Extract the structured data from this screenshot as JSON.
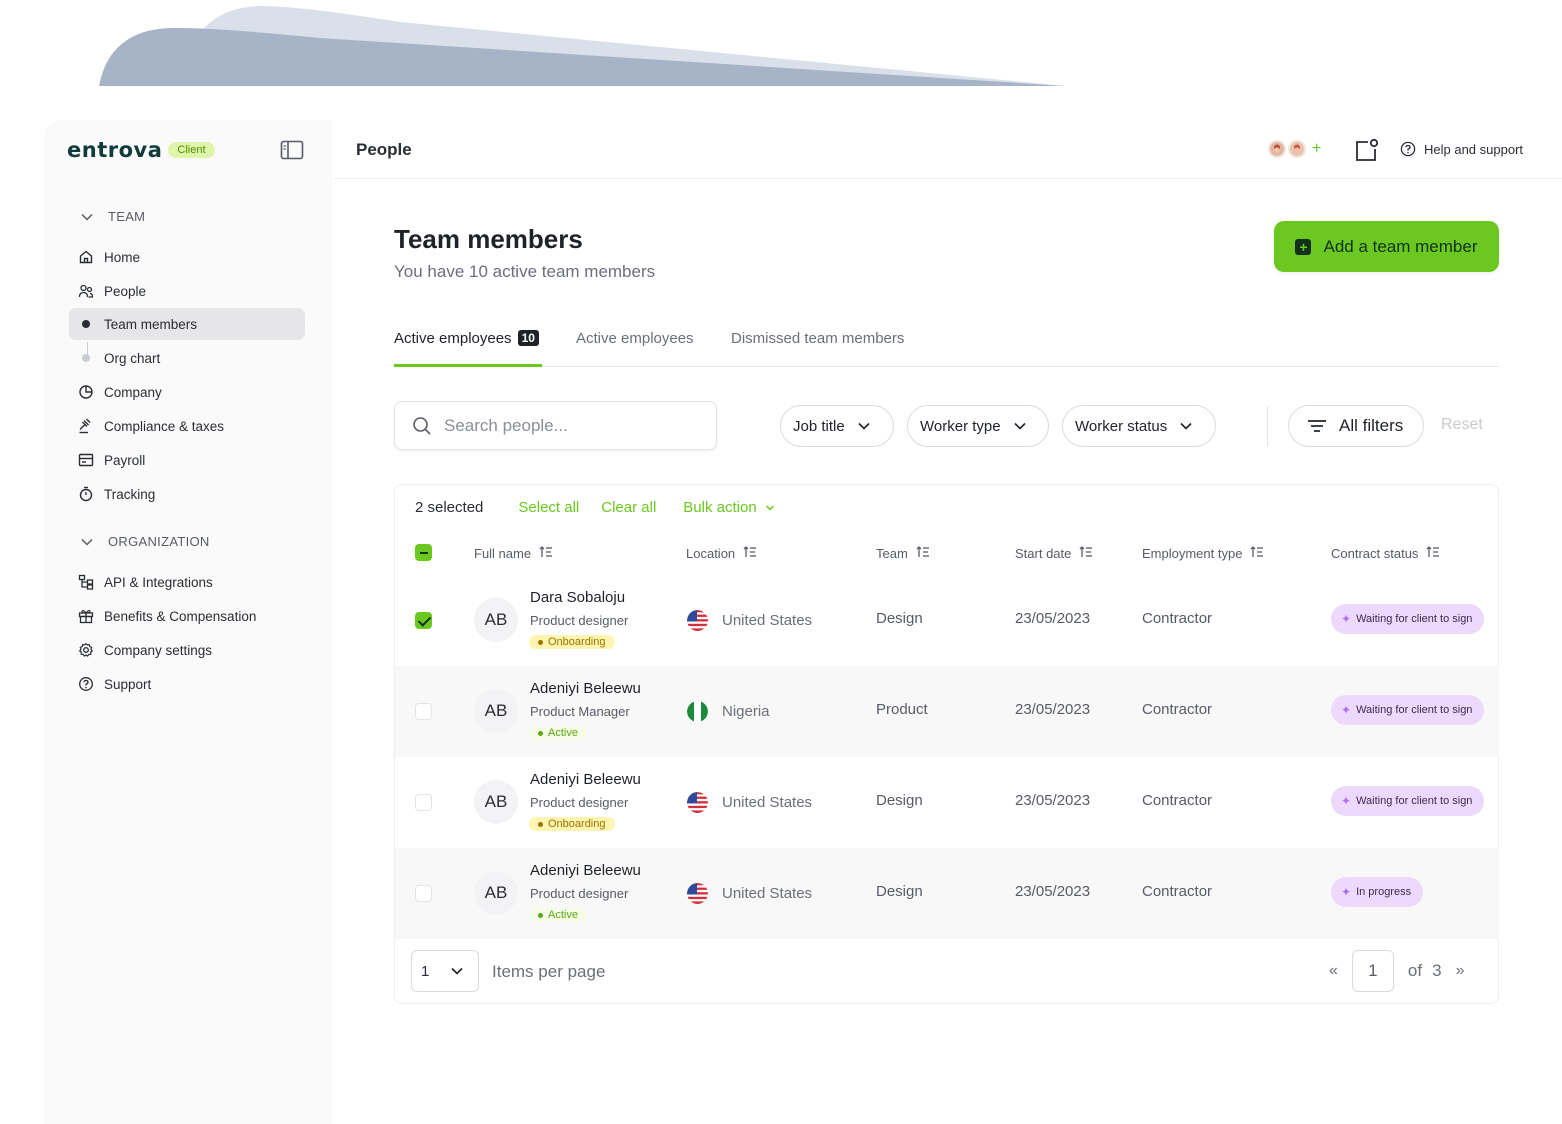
{
  "app": {
    "logo": "entrova",
    "badge": "Client",
    "page_title": "People"
  },
  "sidebar": {
    "sections": [
      {
        "label": "TEAM",
        "items": [
          {
            "label": "Home",
            "icon": "home-icon"
          },
          {
            "label": "People",
            "icon": "people-icon"
          },
          {
            "label": "Team members",
            "icon": "bullet",
            "active": true
          },
          {
            "label": "Org chart",
            "icon": "bullet"
          },
          {
            "label": "Company",
            "icon": "pie-chart-icon"
          },
          {
            "label": "Compliance & taxes",
            "icon": "gavel-icon"
          },
          {
            "label": "Payroll",
            "icon": "payroll-icon"
          },
          {
            "label": "Tracking",
            "icon": "stopwatch-icon"
          }
        ]
      },
      {
        "label": "ORGANIZATION",
        "items": [
          {
            "label": "API & Integrations",
            "icon": "api-icon"
          },
          {
            "label": "Benefits & Compensation",
            "icon": "gift-icon"
          },
          {
            "label": "Company settings",
            "icon": "gear-icon"
          },
          {
            "label": "Support",
            "icon": "help-icon"
          }
        ]
      }
    ]
  },
  "header": {
    "help_label": "Help and support"
  },
  "main": {
    "title": "Team members",
    "subtitle": "You have 10 active team members",
    "add_button": "Add a team member",
    "tabs": [
      {
        "label": "Active employees",
        "count": "10",
        "active": true
      },
      {
        "label": "Active employees"
      },
      {
        "label": "Dismissed team members"
      }
    ],
    "search_placeholder": "Search people...",
    "filters": [
      "Job title",
      "Worker type",
      "Worker status"
    ],
    "all_filters": "All filters",
    "reset": "Reset"
  },
  "table": {
    "selected_text": "2 selected",
    "select_all": "Select all",
    "clear_all": "Clear all",
    "bulk_action": "Bulk action",
    "columns": [
      "Full name",
      "Location",
      "Team",
      "Start date",
      "Employment type",
      "Contract status"
    ],
    "rows": [
      {
        "checked": true,
        "initials": "AB",
        "name": "Dara Sobaloju",
        "role": "Product designer",
        "status": "Onboarding",
        "location": "United States",
        "flag": "us",
        "team": "Design",
        "start_date": "23/05/2023",
        "employment": "Contractor",
        "contract": "Waiting for client to sign"
      },
      {
        "checked": false,
        "initials": "AB",
        "name": "Adeniyi Beleewu",
        "role": "Product Manager",
        "status": "Active",
        "location": "Nigeria",
        "flag": "ng",
        "team": "Product",
        "start_date": "23/05/2023",
        "employment": "Contractor",
        "contract": "Waiting for client to sign"
      },
      {
        "checked": false,
        "initials": "AB",
        "name": "Adeniyi Beleewu",
        "role": "Product designer",
        "status": "Onboarding",
        "location": "United States",
        "flag": "us",
        "team": "Design",
        "start_date": "23/05/2023",
        "employment": "Contractor",
        "contract": "Waiting for client to sign"
      },
      {
        "checked": false,
        "initials": "AB",
        "name": "Adeniyi Beleewu",
        "role": "Product designer",
        "status": "Active",
        "location": "United States",
        "flag": "us",
        "team": "Design",
        "start_date": "23/05/2023",
        "employment": "Contractor",
        "contract": "In progress"
      }
    ],
    "footer": {
      "per_page_value": "1",
      "per_page_label": "Items per page",
      "current_page": "1",
      "of_label": "of",
      "total_pages": "3",
      "prev": "«",
      "next": "»"
    }
  },
  "colors": {
    "accent": "#6bc820",
    "contract_badge": "#ecd9fb",
    "onboarding_badge": "#fff4b0"
  }
}
